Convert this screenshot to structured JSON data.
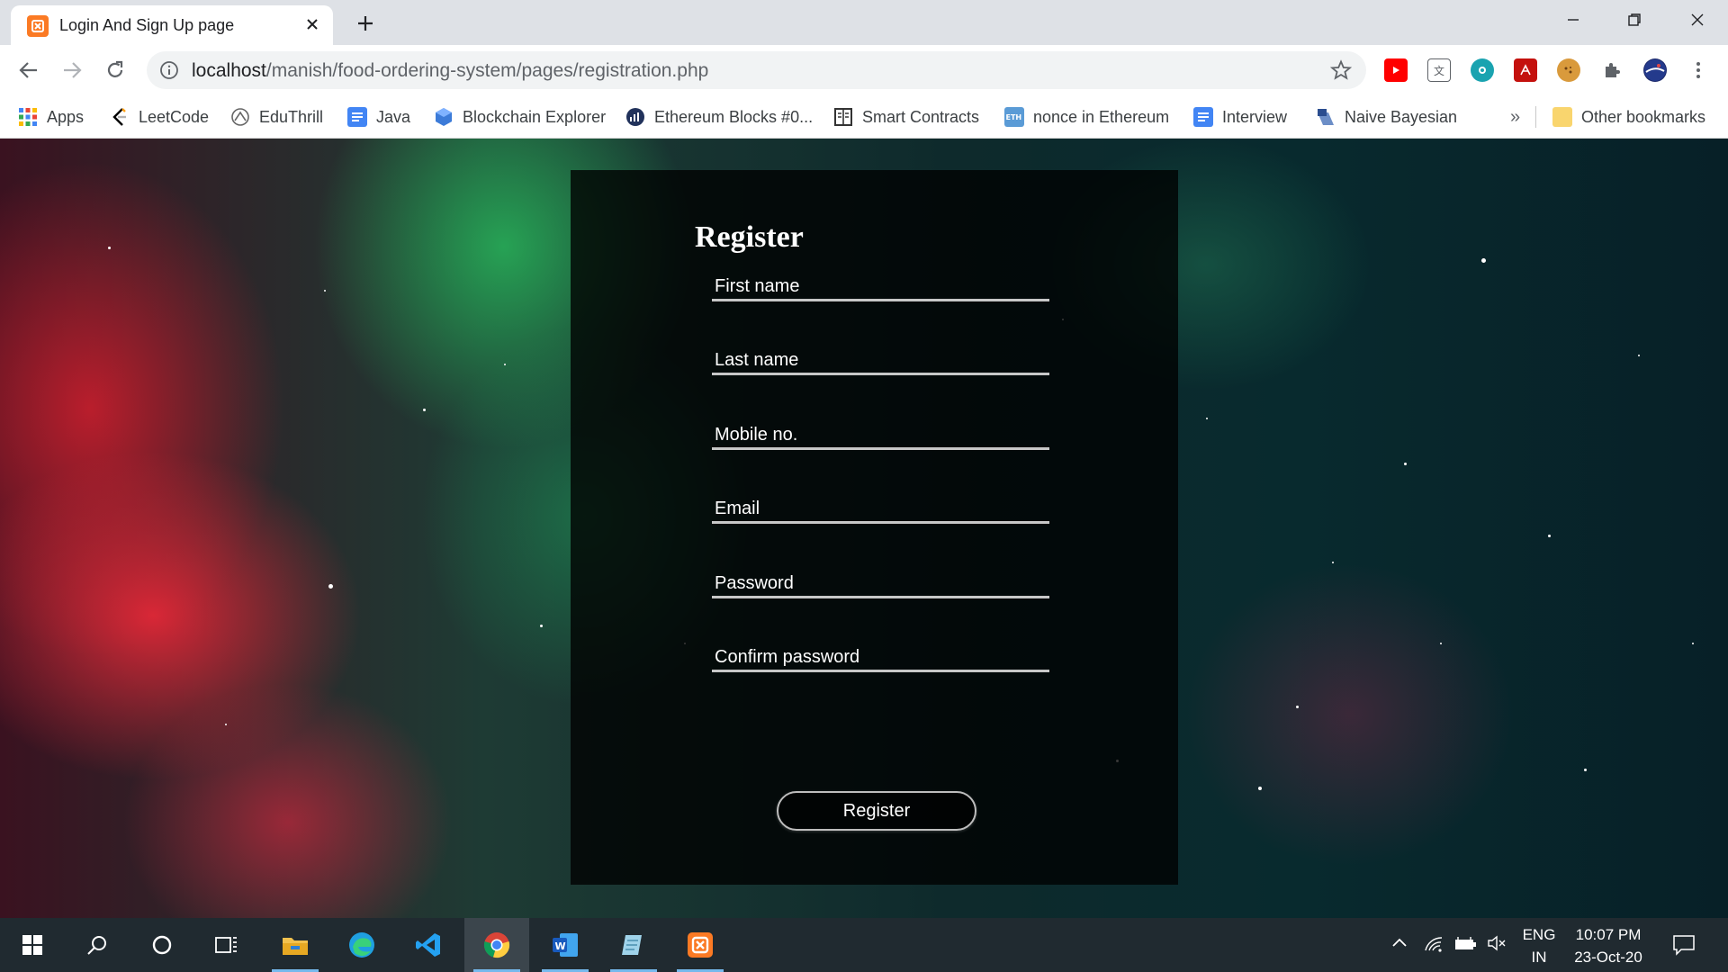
{
  "browser": {
    "tab_title": "Login And Sign Up page",
    "url_host": "localhost",
    "url_path": "/manish/food-ordering-system/pages/registration.php",
    "bookmarks": [
      {
        "label": "Apps",
        "icon": "apps-grid-icon"
      },
      {
        "label": "LeetCode",
        "icon": "leetcode-icon"
      },
      {
        "label": "EduThrill",
        "icon": "eduthrill-icon"
      },
      {
        "label": "Java",
        "icon": "docs-icon"
      },
      {
        "label": "Blockchain Explorer",
        "icon": "blockchain-icon"
      },
      {
        "label": "Ethereum Blocks #0...",
        "icon": "etherscan-icon"
      },
      {
        "label": "Smart Contracts",
        "icon": "book-icon"
      },
      {
        "label": "nonce in Ethereum",
        "icon": "eth-icon"
      },
      {
        "label": "Interview",
        "icon": "docs-icon"
      },
      {
        "label": "Naive Bayesian",
        "icon": "naive-bayes-icon"
      }
    ],
    "more_bookmarks": "»",
    "other_bookmarks": "Other bookmarks"
  },
  "form": {
    "title": "Register",
    "fields": [
      {
        "placeholder": "First name"
      },
      {
        "placeholder": "Last name"
      },
      {
        "placeholder": "Mobile no."
      },
      {
        "placeholder": "Email"
      },
      {
        "placeholder": "Password"
      },
      {
        "placeholder": "Confirm password"
      }
    ],
    "submit_label": "Register"
  },
  "taskbar": {
    "language": "ENG",
    "region": "IN",
    "time": "10:07 PM",
    "date": "23-Oct-20"
  },
  "colors": {
    "chrome_tabstrip": "#dee1e6",
    "card_bg": "rgba(0,0,0,0.78)",
    "field_underline": "#c7c7c7",
    "taskbar": "#202a30",
    "xampp_orange": "#fb7a24"
  }
}
